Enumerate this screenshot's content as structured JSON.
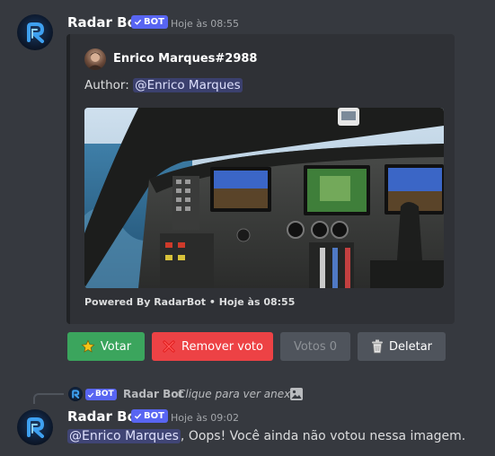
{
  "message1": {
    "username": "Radar Bot",
    "bot_tag": "BOT",
    "timestamp": "Hoje às 08:55",
    "embed": {
      "author_name": "Enrico Marques#2988",
      "description_prefix": "Author: ",
      "description_mention": "@Enrico Marques",
      "footer": "Powered By RadarBot • Hoje às 08:55"
    },
    "buttons": [
      {
        "label": "Votar",
        "icon": "star-icon"
      },
      {
        "label": "Remover voto",
        "icon": "cross-mark-icon"
      },
      {
        "label": "Votos 0",
        "disabled": true
      },
      {
        "label": "Deletar",
        "icon": "trash-icon"
      }
    ]
  },
  "message2": {
    "reply": {
      "bot_tag": "BOT",
      "username": "Radar Bot",
      "text": "Clique para ver anexo",
      "icon": "image-icon"
    },
    "username": "Radar Bot",
    "bot_tag": "BOT",
    "timestamp": "Hoje às 09:02",
    "mention": "@Enrico Marques",
    "text": ", Oops! Você ainda não votou nessa imagem."
  },
  "colors": {
    "background": "#36393f",
    "embed_bg": "#2f3136",
    "blurple": "#5865f2",
    "green": "#3ba55d",
    "red": "#ed4245",
    "gray": "#4f545c"
  }
}
